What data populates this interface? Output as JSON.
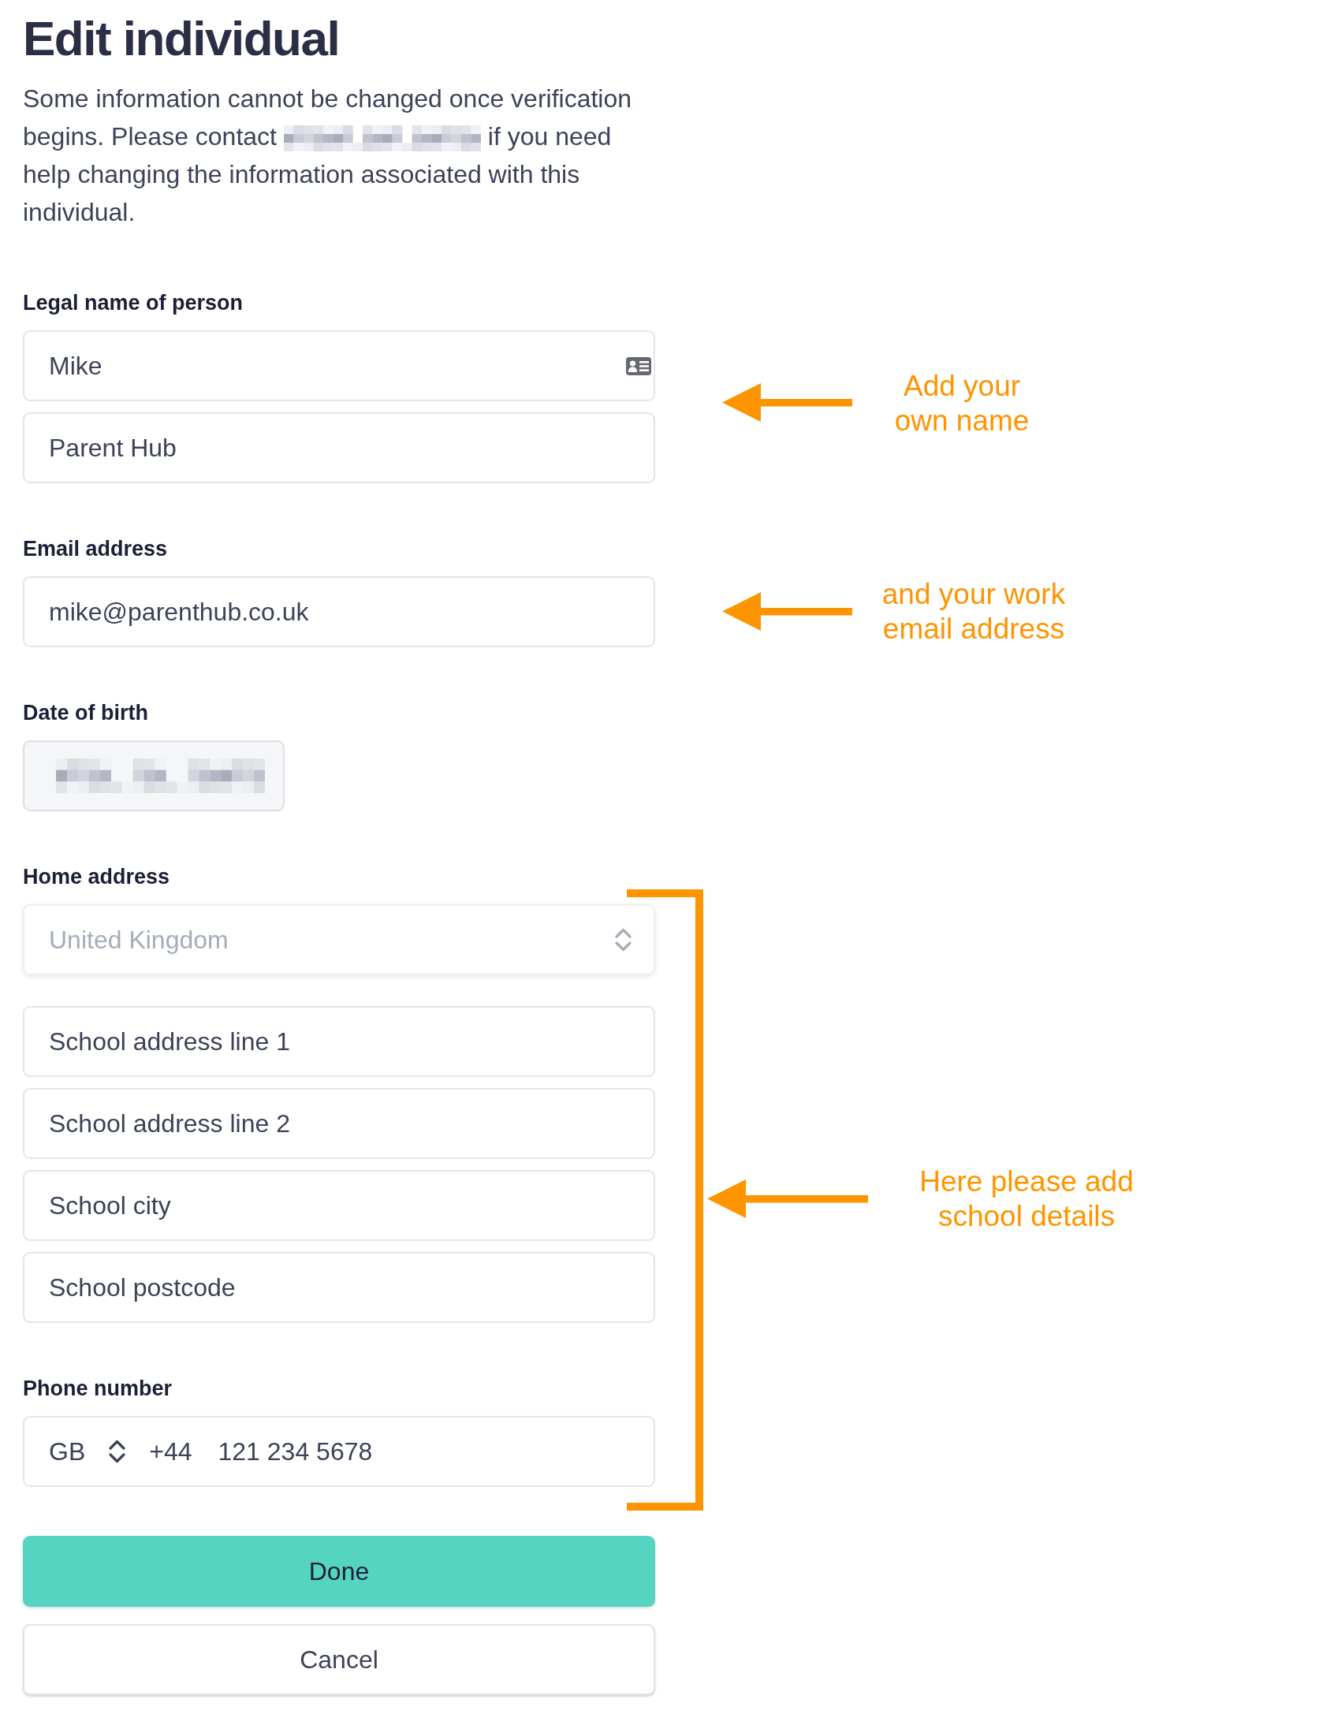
{
  "title": "Edit individual",
  "description": [
    {
      "kind": "text",
      "text": "Some information cannot be changed once verification begins. Please contact"
    },
    {
      "kind": "redacted"
    },
    {
      "kind": "text",
      "text": "if you need help changing the information associated with this individual."
    }
  ],
  "sections": [
    {
      "label": "Legal name of person",
      "fields": [
        {
          "kind": "text",
          "value": "Mike",
          "autofill": true
        },
        {
          "kind": "text",
          "value": "Parent Hub",
          "autofill": false
        }
      ]
    },
    {
      "label": "Email address",
      "fields": [
        {
          "kind": "text",
          "value": "mike@parenthub.co.uk",
          "autofill": false
        }
      ]
    },
    {
      "label": "Date of birth",
      "fields": [
        {
          "kind": "date",
          "disabled": true,
          "redacted": true
        }
      ]
    },
    {
      "label": "Home address",
      "fields": [
        {
          "kind": "select",
          "value": "United Kingdom",
          "disabled": true
        },
        {
          "kind": "text",
          "value": "School address line 1",
          "autofill": false
        },
        {
          "kind": "text",
          "value": "School address line 2",
          "autofill": false
        },
        {
          "kind": "text",
          "value": "School city",
          "autofill": false
        },
        {
          "kind": "text",
          "value": "School postcode",
          "autofill": false
        }
      ]
    },
    {
      "label": "Phone number",
      "fields": [
        {
          "kind": "phone",
          "country": "GB",
          "dial_code": "+44",
          "value": "121 234 5678"
        }
      ]
    }
  ],
  "buttons": [
    {
      "kind": "primary",
      "label": "Done"
    },
    {
      "kind": "secondary",
      "label": "Cancel"
    }
  ],
  "annotations": [
    {
      "text": "Add your own name",
      "bracket": false
    },
    {
      "text": "and your work email address",
      "bracket": false
    },
    {
      "text": "Here please add school details",
      "bracket": true
    }
  ]
}
